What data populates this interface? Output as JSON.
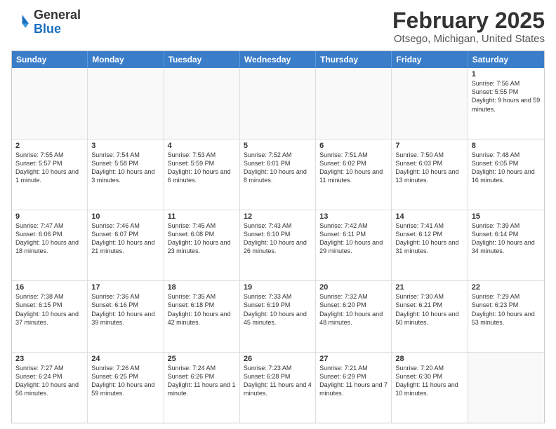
{
  "header": {
    "logo_general": "General",
    "logo_blue": "Blue",
    "calendar_title": "February 2025",
    "calendar_subtitle": "Otsego, Michigan, United States"
  },
  "weekdays": [
    "Sunday",
    "Monday",
    "Tuesday",
    "Wednesday",
    "Thursday",
    "Friday",
    "Saturday"
  ],
  "rows": [
    [
      {
        "num": "",
        "text": "",
        "empty": true
      },
      {
        "num": "",
        "text": "",
        "empty": true
      },
      {
        "num": "",
        "text": "",
        "empty": true
      },
      {
        "num": "",
        "text": "",
        "empty": true
      },
      {
        "num": "",
        "text": "",
        "empty": true
      },
      {
        "num": "",
        "text": "",
        "empty": true
      },
      {
        "num": "1",
        "text": "Sunrise: 7:56 AM\nSunset: 5:55 PM\nDaylight: 9 hours and 59 minutes."
      }
    ],
    [
      {
        "num": "2",
        "text": "Sunrise: 7:55 AM\nSunset: 5:57 PM\nDaylight: 10 hours and 1 minute."
      },
      {
        "num": "3",
        "text": "Sunrise: 7:54 AM\nSunset: 5:58 PM\nDaylight: 10 hours and 3 minutes."
      },
      {
        "num": "4",
        "text": "Sunrise: 7:53 AM\nSunset: 5:59 PM\nDaylight: 10 hours and 6 minutes."
      },
      {
        "num": "5",
        "text": "Sunrise: 7:52 AM\nSunset: 6:01 PM\nDaylight: 10 hours and 8 minutes."
      },
      {
        "num": "6",
        "text": "Sunrise: 7:51 AM\nSunset: 6:02 PM\nDaylight: 10 hours and 11 minutes."
      },
      {
        "num": "7",
        "text": "Sunrise: 7:50 AM\nSunset: 6:03 PM\nDaylight: 10 hours and 13 minutes."
      },
      {
        "num": "8",
        "text": "Sunrise: 7:48 AM\nSunset: 6:05 PM\nDaylight: 10 hours and 16 minutes."
      }
    ],
    [
      {
        "num": "9",
        "text": "Sunrise: 7:47 AM\nSunset: 6:06 PM\nDaylight: 10 hours and 18 minutes."
      },
      {
        "num": "10",
        "text": "Sunrise: 7:46 AM\nSunset: 6:07 PM\nDaylight: 10 hours and 21 minutes."
      },
      {
        "num": "11",
        "text": "Sunrise: 7:45 AM\nSunset: 6:08 PM\nDaylight: 10 hours and 23 minutes."
      },
      {
        "num": "12",
        "text": "Sunrise: 7:43 AM\nSunset: 6:10 PM\nDaylight: 10 hours and 26 minutes."
      },
      {
        "num": "13",
        "text": "Sunrise: 7:42 AM\nSunset: 6:11 PM\nDaylight: 10 hours and 29 minutes."
      },
      {
        "num": "14",
        "text": "Sunrise: 7:41 AM\nSunset: 6:12 PM\nDaylight: 10 hours and 31 minutes."
      },
      {
        "num": "15",
        "text": "Sunrise: 7:39 AM\nSunset: 6:14 PM\nDaylight: 10 hours and 34 minutes."
      }
    ],
    [
      {
        "num": "16",
        "text": "Sunrise: 7:38 AM\nSunset: 6:15 PM\nDaylight: 10 hours and 37 minutes."
      },
      {
        "num": "17",
        "text": "Sunrise: 7:36 AM\nSunset: 6:16 PM\nDaylight: 10 hours and 39 minutes."
      },
      {
        "num": "18",
        "text": "Sunrise: 7:35 AM\nSunset: 6:18 PM\nDaylight: 10 hours and 42 minutes."
      },
      {
        "num": "19",
        "text": "Sunrise: 7:33 AM\nSunset: 6:19 PM\nDaylight: 10 hours and 45 minutes."
      },
      {
        "num": "20",
        "text": "Sunrise: 7:32 AM\nSunset: 6:20 PM\nDaylight: 10 hours and 48 minutes."
      },
      {
        "num": "21",
        "text": "Sunrise: 7:30 AM\nSunset: 6:21 PM\nDaylight: 10 hours and 50 minutes."
      },
      {
        "num": "22",
        "text": "Sunrise: 7:29 AM\nSunset: 6:23 PM\nDaylight: 10 hours and 53 minutes."
      }
    ],
    [
      {
        "num": "23",
        "text": "Sunrise: 7:27 AM\nSunset: 6:24 PM\nDaylight: 10 hours and 56 minutes."
      },
      {
        "num": "24",
        "text": "Sunrise: 7:26 AM\nSunset: 6:25 PM\nDaylight: 10 hours and 59 minutes."
      },
      {
        "num": "25",
        "text": "Sunrise: 7:24 AM\nSunset: 6:26 PM\nDaylight: 11 hours and 1 minute."
      },
      {
        "num": "26",
        "text": "Sunrise: 7:23 AM\nSunset: 6:28 PM\nDaylight: 11 hours and 4 minutes."
      },
      {
        "num": "27",
        "text": "Sunrise: 7:21 AM\nSunset: 6:29 PM\nDaylight: 11 hours and 7 minutes."
      },
      {
        "num": "28",
        "text": "Sunrise: 7:20 AM\nSunset: 6:30 PM\nDaylight: 11 hours and 10 minutes."
      },
      {
        "num": "",
        "text": "",
        "empty": true
      }
    ]
  ]
}
